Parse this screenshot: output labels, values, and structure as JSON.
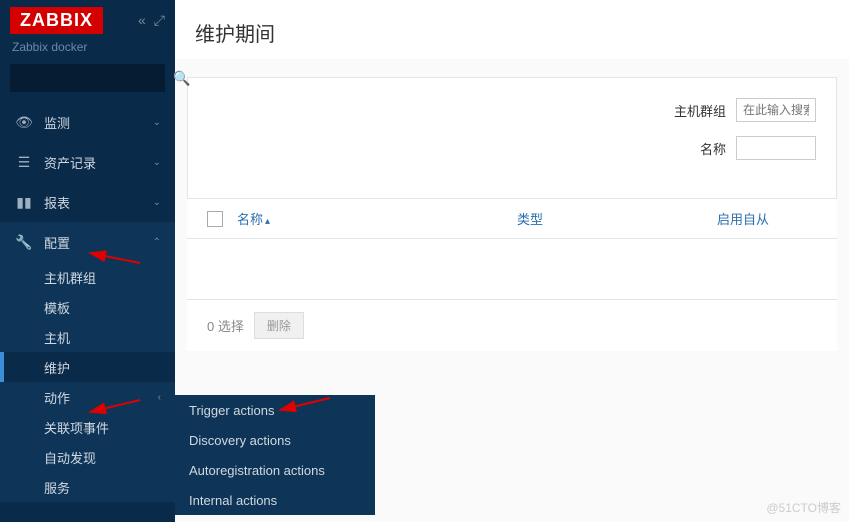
{
  "header": {
    "logo": "ZABBIX",
    "subtitle": "Zabbix docker"
  },
  "search": {
    "placeholder": ""
  },
  "nav": [
    {
      "icon": "eye",
      "label": "监测"
    },
    {
      "icon": "list",
      "label": "资产记录"
    },
    {
      "icon": "chart",
      "label": "报表"
    },
    {
      "icon": "wrench",
      "label": "配置",
      "expanded": true
    }
  ],
  "submenu": [
    {
      "label": "主机群组"
    },
    {
      "label": "模板"
    },
    {
      "label": "主机"
    },
    {
      "label": "维护",
      "active": true
    },
    {
      "label": "动作",
      "has_children": true
    },
    {
      "label": "关联项事件"
    },
    {
      "label": "自动发现"
    },
    {
      "label": "服务"
    }
  ],
  "flyout": [
    {
      "label": "Trigger actions"
    },
    {
      "label": "Discovery actions"
    },
    {
      "label": "Autoregistration actions"
    },
    {
      "label": "Internal actions"
    }
  ],
  "page": {
    "title": "维护期间"
  },
  "filter": {
    "hostgroup_label": "主机群组",
    "hostgroup_placeholder": "在此输入搜索",
    "name_label": "名称",
    "name_value": ""
  },
  "table": {
    "columns": {
      "name": "名称",
      "type": "类型",
      "enabled_since": "启用自从"
    }
  },
  "selection": {
    "count_label": "0 选择",
    "delete_label": "删除"
  },
  "watermark": "@51CTO博客"
}
